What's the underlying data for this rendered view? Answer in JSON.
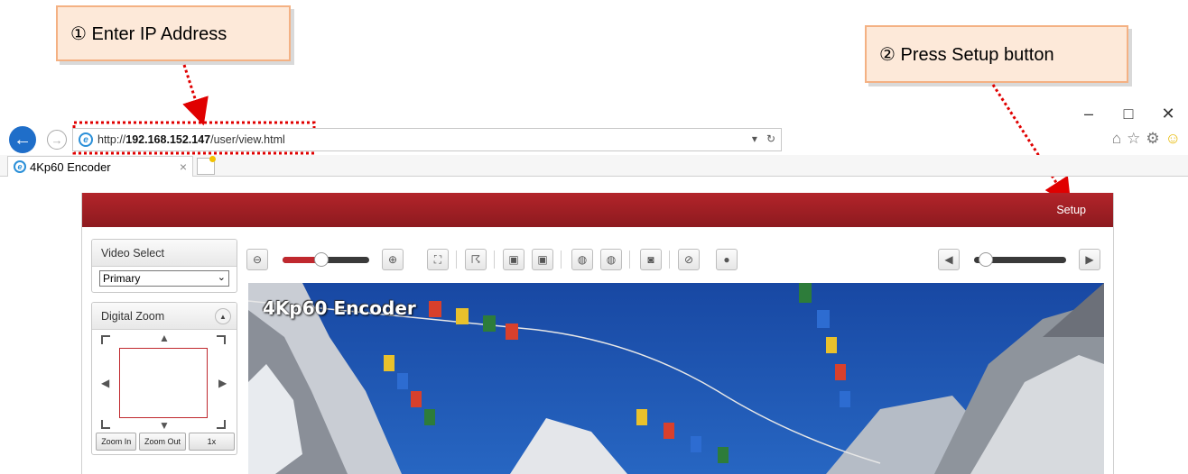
{
  "callouts": {
    "step1": "① Enter IP Address",
    "step2": "② Press Setup button"
  },
  "browser": {
    "url_scheme": "http://",
    "url_host": "192.168.152.147",
    "url_path": "/user/view.html",
    "tab_title": "4Kp60 Encoder",
    "window_controls": [
      "–",
      "□",
      "✕"
    ],
    "toolbar_icons": [
      "home-icon",
      "star-icon",
      "gear-icon",
      "smiley-icon"
    ]
  },
  "page": {
    "setup_label": "Setup",
    "video_select": {
      "title": "Video Select",
      "selected": "Primary"
    },
    "digital_zoom": {
      "title": "Digital Zoom",
      "buttons": [
        "Zoom In",
        "Zoom Out",
        "1x"
      ]
    },
    "toolbar": {
      "zoom_slider_value": 0.45,
      "playback_slider_value": 0.05
    },
    "video_overlay_title": "4Kp60 Encoder"
  },
  "colors": {
    "banner": "#a11f25",
    "accent_red": "#c0282e",
    "callout_fill": "#fde9d9",
    "callout_border": "#f4b183",
    "ie_blue": "#1f6ec9"
  }
}
